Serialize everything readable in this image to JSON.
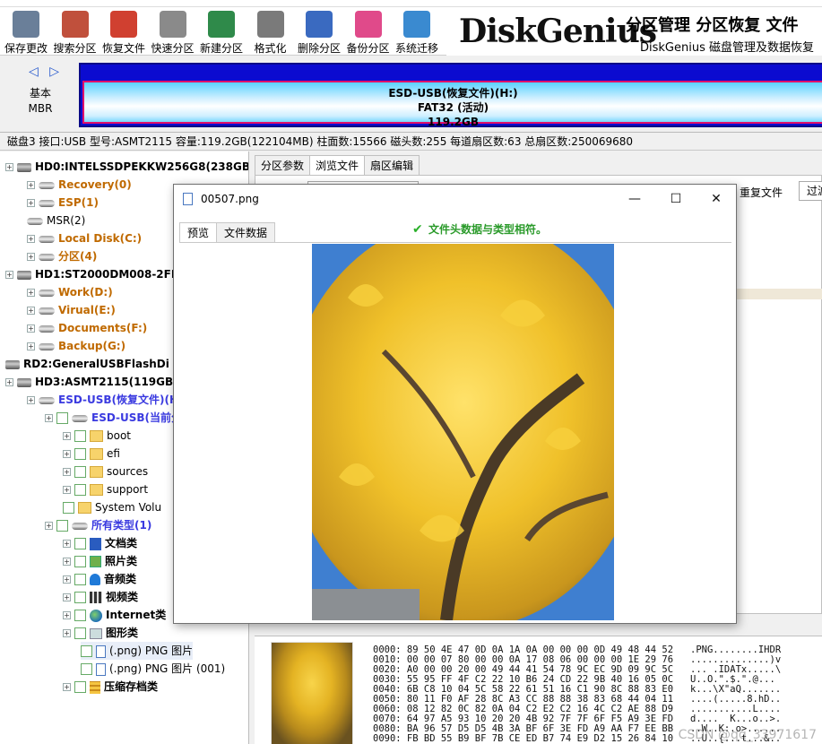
{
  "toolbar": {
    "buttons": [
      {
        "label": "保存更改",
        "icon": "save-icon",
        "color": "#6a7f99"
      },
      {
        "label": "搜索分区",
        "icon": "search-partition-icon",
        "color": "#c0503c"
      },
      {
        "label": "恢复文件",
        "icon": "restore-file-icon",
        "color": "#d04030"
      },
      {
        "label": "快速分区",
        "icon": "quick-partition-icon",
        "color": "#8a8a8a"
      },
      {
        "label": "新建分区",
        "icon": "new-partition-icon",
        "color": "#2f8a4a"
      },
      {
        "label": "格式化",
        "icon": "format-icon",
        "color": "#7a7a7a"
      },
      {
        "label": "删除分区",
        "icon": "delete-partition-icon",
        "color": "#3a6ac0"
      },
      {
        "label": "备份分区",
        "icon": "backup-partition-icon",
        "color": "#e04a8a"
      },
      {
        "label": "系统迁移",
        "icon": "system-migrate-icon",
        "color": "#3a8ad0"
      }
    ]
  },
  "brand": {
    "logo": "DiskGenius",
    "tagline": "分区管理 分区恢复 文件",
    "subtitle": "DiskGenius 磁盘管理及数据恢复"
  },
  "diskbar": {
    "nav_arrows": "◁ ▷",
    "mbr_line1": "基本",
    "mbr_line2": "MBR",
    "partition_name": "ESD-USB(恢复文件)(H:)",
    "partition_fs": "FAT32 (活动)",
    "partition_size": "119.2GB"
  },
  "disk_info": "磁盘3 接口:USB  型号:ASMT2115  容量:119.2GB(122104MB)  柱面数:15566  磁头数:255  每道扇区数:63  总扇区数:250069680",
  "tree": {
    "items": [
      {
        "label": "HD0:INTELSSDPEKKW256G8(238GB)",
        "style": "bold",
        "icon": "hdd"
      },
      {
        "label": "Recovery(0)",
        "style": "orange",
        "icon": "part"
      },
      {
        "label": "ESP(1)",
        "style": "orange",
        "icon": "part"
      },
      {
        "label": "MSR(2)",
        "style": "plain",
        "icon": "part"
      },
      {
        "label": "Local Disk(C:)",
        "style": "orange",
        "icon": "part"
      },
      {
        "label": "分区(4)",
        "style": "orange",
        "icon": "part"
      },
      {
        "label": "HD1:ST2000DM008-2FR",
        "style": "bold",
        "icon": "hdd"
      },
      {
        "label": "Work(D:)",
        "style": "orange",
        "icon": "part"
      },
      {
        "label": "Virual(E:)",
        "style": "orange",
        "icon": "part"
      },
      {
        "label": "Documents(F:)",
        "style": "orange",
        "icon": "part"
      },
      {
        "label": "Backup(G:)",
        "style": "orange",
        "icon": "part"
      },
      {
        "label": "RD2:GeneralUSBFlashDi",
        "style": "bold",
        "icon": "hdd"
      },
      {
        "label": "HD3:ASMT2115(119GB)",
        "style": "bold",
        "icon": "hdd"
      },
      {
        "label": "ESD-USB(恢复文件)(H",
        "style": "blue",
        "icon": "part"
      },
      {
        "label": "ESD-USB(当前分",
        "style": "blue",
        "icon": "part"
      },
      {
        "label": "boot",
        "style": "plain",
        "icon": "folder"
      },
      {
        "label": "efi",
        "style": "plain",
        "icon": "folder"
      },
      {
        "label": "sources",
        "style": "plain",
        "icon": "folder"
      },
      {
        "label": "support",
        "style": "plain",
        "icon": "folder"
      },
      {
        "label": "System Volu",
        "style": "plain",
        "icon": "folder"
      },
      {
        "label": "所有类型(1)",
        "style": "blue",
        "icon": "part"
      },
      {
        "label": "文档类",
        "style": "bold",
        "icon": "doc"
      },
      {
        "label": "照片类",
        "style": "bold",
        "icon": "img"
      },
      {
        "label": "音频类",
        "style": "bold",
        "icon": "music"
      },
      {
        "label": "视频类",
        "style": "bold",
        "icon": "film"
      },
      {
        "label": "Internet类",
        "style": "bold",
        "icon": "globe"
      },
      {
        "label": "图形类",
        "style": "bold",
        "icon": "shape"
      },
      {
        "label": "(.png) PNG 图片",
        "style": "plain",
        "icon": "file"
      },
      {
        "label": "(.png) PNG 图片 (001)",
        "style": "plain",
        "icon": "file"
      },
      {
        "label": "压缩存档类",
        "style": "bold",
        "icon": "zip"
      }
    ]
  },
  "right_panel": {
    "tabs": [
      "分区参数",
      "浏览文件",
      "扇区编辑"
    ],
    "active_tab": 1,
    "repeat_label": "重复文件",
    "filter_label": "过滤"
  },
  "hex": {
    "lines": [
      "0000: 89 50 4E 47 0D 0A 1A 0A 00 00 00 0D 49 48 44 52   .PNG........IHDR",
      "0010: 00 00 07 80 00 00 0A 17 08 06 00 00 00 1E 29 76   ..............)v",
      "0020: A0 00 00 20 00 49 44 41 54 78 9C EC 9D 09 9C 5C   ... .IDATx.....\\",
      "0030: 55 95 FF 4F C2 22 10 B6 24 CD 22 9B 40 16 05 0C   U..O.\".$.\".@...",
      "0040: 6B C8 10 04 5C 58 22 61 51 16 C1 90 8C 88 83 E0   k...\\X\"aQ.......",
      "0050: 80 11 F0 AF 28 8C A3 CC 88 88 38 83 68 44 04 11   ....(.....8.hD..",
      "0060: 08 12 82 0C 82 0A 04 C2 E2 C2 16 4C C2 AE 88 D9   ...........L....",
      "0070: 64 97 A5 93 10 20 20 4B 92 7F 7F 6F F5 A9 3E FD   d....  K...o..>.",
      "0080: BA 96 57 D5 D5 4B 3A BF 6F 3E FD A9 AA F7 EE BB   ..W..K:.o>......",
      "0090: FB BD 55 B9 BF 7B CE ED B7 74 E9 D2 15 26 84 10   ..U..{...t...&.."
    ],
    "watermark": "CSDN @qq_33971617"
  },
  "dialog": {
    "title": "00507.png",
    "min_label": "—",
    "max_label": "☐",
    "close_label": "✕",
    "tabs": [
      "预览",
      "文件数据"
    ],
    "active_tab": 0,
    "status_check": "✔",
    "status": "文件头数据与类型相符。"
  }
}
